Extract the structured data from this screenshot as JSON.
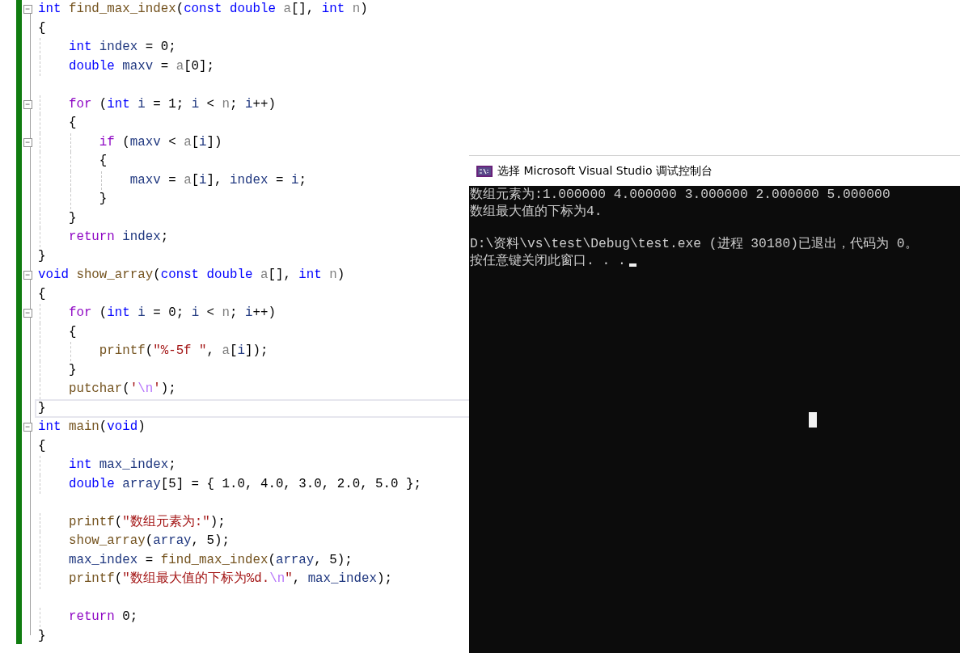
{
  "editor": {
    "lines": [
      {
        "expanded": true,
        "highlighted": false,
        "tokens": [
          {
            "text": "int",
            "kind": "kw"
          },
          {
            "text": " find_max_index",
            "kind": "fn"
          },
          {
            "text": "(",
            "kind": "plain"
          },
          {
            "text": "const",
            "kind": "kw"
          },
          {
            "text": " double",
            "kind": "kw"
          },
          {
            "text": " a",
            "kind": "param"
          },
          {
            "text": "[], ",
            "kind": "plain"
          },
          {
            "text": "int",
            "kind": "kw"
          },
          {
            "text": " n",
            "kind": "param"
          },
          {
            "text": ")",
            "kind": "plain"
          }
        ]
      },
      {
        "highlighted": false,
        "tokens": [
          {
            "text": "{",
            "kind": "plain"
          }
        ]
      },
      {
        "highlighted": false,
        "tokens": [
          {
            "text": "    int",
            "kind": "kw"
          },
          {
            "text": " index",
            "kind": "var"
          },
          {
            "text": " = 0;",
            "kind": "plain"
          }
        ]
      },
      {
        "highlighted": false,
        "tokens": [
          {
            "text": "    double",
            "kind": "kw"
          },
          {
            "text": " maxv",
            "kind": "var"
          },
          {
            "text": " = ",
            "kind": "plain"
          },
          {
            "text": "a",
            "kind": "param"
          },
          {
            "text": "[0];",
            "kind": "plain"
          }
        ]
      },
      {
        "highlighted": false
      },
      {
        "expanded": true,
        "highlighted": false,
        "tokens": [
          {
            "text": "    for",
            "kind": "ctl"
          },
          {
            "text": " (",
            "kind": "plain"
          },
          {
            "text": "int",
            "kind": "kw"
          },
          {
            "text": " i",
            "kind": "var"
          },
          {
            "text": " = 1; ",
            "kind": "plain"
          },
          {
            "text": "i",
            "kind": "var"
          },
          {
            "text": " < ",
            "kind": "plain"
          },
          {
            "text": "n",
            "kind": "param"
          },
          {
            "text": "; ",
            "kind": "plain"
          },
          {
            "text": "i",
            "kind": "var"
          },
          {
            "text": "++)",
            "kind": "plain"
          }
        ]
      },
      {
        "highlighted": false,
        "tokens": [
          {
            "text": "    {",
            "kind": "plain"
          }
        ]
      },
      {
        "expanded": true,
        "highlighted": false,
        "tokens": [
          {
            "text": "        if",
            "kind": "ctl"
          },
          {
            "text": " (",
            "kind": "plain"
          },
          {
            "text": "maxv",
            "kind": "var"
          },
          {
            "text": " < ",
            "kind": "plain"
          },
          {
            "text": "a",
            "kind": "param"
          },
          {
            "text": "[",
            "kind": "plain"
          },
          {
            "text": "i",
            "kind": "var"
          },
          {
            "text": "])",
            "kind": "plain"
          }
        ]
      },
      {
        "highlighted": false,
        "tokens": [
          {
            "text": "        {",
            "kind": "plain"
          }
        ]
      },
      {
        "highlighted": false,
        "tokens": [
          {
            "text": "            maxv",
            "kind": "var"
          },
          {
            "text": " = ",
            "kind": "plain"
          },
          {
            "text": "a",
            "kind": "param"
          },
          {
            "text": "[",
            "kind": "plain"
          },
          {
            "text": "i",
            "kind": "var"
          },
          {
            "text": "], ",
            "kind": "plain"
          },
          {
            "text": "index",
            "kind": "var"
          },
          {
            "text": " = ",
            "kind": "plain"
          },
          {
            "text": "i",
            "kind": "var"
          },
          {
            "text": ";",
            "kind": "plain"
          }
        ]
      },
      {
        "highlighted": false,
        "tokens": [
          {
            "text": "        }",
            "kind": "plain"
          }
        ]
      },
      {
        "highlighted": false,
        "tokens": [
          {
            "text": "    }",
            "kind": "plain"
          }
        ]
      },
      {
        "highlighted": false,
        "tokens": [
          {
            "text": "    return",
            "kind": "ctl"
          },
          {
            "text": " index",
            "kind": "var"
          },
          {
            "text": ";",
            "kind": "plain"
          }
        ]
      },
      {
        "highlighted": false,
        "tokens": [
          {
            "text": "}",
            "kind": "plain"
          }
        ]
      },
      {
        "expanded": true,
        "highlighted": false,
        "tokens": [
          {
            "text": "void",
            "kind": "kw"
          },
          {
            "text": " show_array",
            "kind": "fn"
          },
          {
            "text": "(",
            "kind": "plain"
          },
          {
            "text": "const",
            "kind": "kw"
          },
          {
            "text": " double",
            "kind": "kw"
          },
          {
            "text": " a",
            "kind": "param"
          },
          {
            "text": "[], ",
            "kind": "plain"
          },
          {
            "text": "int",
            "kind": "kw"
          },
          {
            "text": " n",
            "kind": "param"
          },
          {
            "text": ")",
            "kind": "plain"
          }
        ]
      },
      {
        "highlighted": false,
        "tokens": [
          {
            "text": "{",
            "kind": "plain"
          }
        ]
      },
      {
        "expanded": true,
        "highlighted": false,
        "tokens": [
          {
            "text": "    for",
            "kind": "ctl"
          },
          {
            "text": " (",
            "kind": "plain"
          },
          {
            "text": "int",
            "kind": "kw"
          },
          {
            "text": " i",
            "kind": "var"
          },
          {
            "text": " = 0; ",
            "kind": "plain"
          },
          {
            "text": "i",
            "kind": "var"
          },
          {
            "text": " < ",
            "kind": "plain"
          },
          {
            "text": "n",
            "kind": "param"
          },
          {
            "text": "; ",
            "kind": "plain"
          },
          {
            "text": "i",
            "kind": "var"
          },
          {
            "text": "++)",
            "kind": "plain"
          }
        ]
      },
      {
        "highlighted": false,
        "tokens": [
          {
            "text": "    {",
            "kind": "plain"
          }
        ]
      },
      {
        "highlighted": false,
        "tokens": [
          {
            "text": "        printf",
            "kind": "fn"
          },
          {
            "text": "(",
            "kind": "plain"
          },
          {
            "text": "\"%-5f \"",
            "kind": "str"
          },
          {
            "text": ", ",
            "kind": "plain"
          },
          {
            "text": "a",
            "kind": "param"
          },
          {
            "text": "[",
            "kind": "plain"
          },
          {
            "text": "i",
            "kind": "var"
          },
          {
            "text": "]);",
            "kind": "plain"
          }
        ]
      },
      {
        "highlighted": false,
        "tokens": [
          {
            "text": "    }",
            "kind": "plain"
          }
        ]
      },
      {
        "highlighted": false,
        "tokens": [
          {
            "text": "    putchar",
            "kind": "fn"
          },
          {
            "text": "(",
            "kind": "plain"
          },
          {
            "text": "'",
            "kind": "str"
          },
          {
            "text": "\\n",
            "kind": "esc"
          },
          {
            "text": "'",
            "kind": "str"
          },
          {
            "text": ");",
            "kind": "plain"
          }
        ]
      },
      {
        "highlighted": true,
        "tokens": [
          {
            "text": "}",
            "kind": "plain"
          }
        ]
      },
      {
        "expanded": true,
        "highlighted": false,
        "tokens": [
          {
            "text": "int",
            "kind": "kw"
          },
          {
            "text": " main",
            "kind": "fn"
          },
          {
            "text": "(",
            "kind": "plain"
          },
          {
            "text": "void",
            "kind": "kw"
          },
          {
            "text": ")",
            "kind": "plain"
          }
        ]
      },
      {
        "highlighted": false,
        "tokens": [
          {
            "text": "{",
            "kind": "plain"
          }
        ]
      },
      {
        "highlighted": false,
        "tokens": [
          {
            "text": "    int",
            "kind": "kw"
          },
          {
            "text": " max_index",
            "kind": "var"
          },
          {
            "text": ";",
            "kind": "plain"
          }
        ]
      },
      {
        "highlighted": false,
        "tokens": [
          {
            "text": "    double",
            "kind": "kw"
          },
          {
            "text": " array",
            "kind": "var"
          },
          {
            "text": "[5] = { 1.0, 4.0, 3.0, 2.0, 5.0 };",
            "kind": "plain"
          }
        ]
      },
      {
        "highlighted": false
      },
      {
        "highlighted": false,
        "tokens": [
          {
            "text": "    printf",
            "kind": "fn"
          },
          {
            "text": "(",
            "kind": "plain"
          },
          {
            "text": "\"数组元素为:\"",
            "kind": "str"
          },
          {
            "text": ");",
            "kind": "plain"
          }
        ]
      },
      {
        "highlighted": false,
        "tokens": [
          {
            "text": "    show_array",
            "kind": "fn"
          },
          {
            "text": "(",
            "kind": "plain"
          },
          {
            "text": "array",
            "kind": "var"
          },
          {
            "text": ", 5);",
            "kind": "plain"
          }
        ]
      },
      {
        "highlighted": false,
        "tokens": [
          {
            "text": "    max_index",
            "kind": "var"
          },
          {
            "text": " = ",
            "kind": "plain"
          },
          {
            "text": "find_max_index",
            "kind": "fn"
          },
          {
            "text": "(",
            "kind": "plain"
          },
          {
            "text": "array",
            "kind": "var"
          },
          {
            "text": ", 5);",
            "kind": "plain"
          }
        ]
      },
      {
        "highlighted": false,
        "tokens": [
          {
            "text": "    printf",
            "kind": "fn"
          },
          {
            "text": "(",
            "kind": "plain"
          },
          {
            "text": "\"数组最大值的下标为%d.",
            "kind": "str"
          },
          {
            "text": "\\n",
            "kind": "esc"
          },
          {
            "text": "\"",
            "kind": "str"
          },
          {
            "text": ", ",
            "kind": "plain"
          },
          {
            "text": "max_index",
            "kind": "var"
          },
          {
            "text": ");",
            "kind": "plain"
          }
        ]
      },
      {
        "highlighted": false
      },
      {
        "highlighted": false,
        "tokens": [
          {
            "text": "    return",
            "kind": "ctl"
          },
          {
            "text": " 0;",
            "kind": "plain"
          }
        ]
      },
      {
        "highlighted": false,
        "tokens": [
          {
            "text": "}",
            "kind": "plain"
          }
        ]
      }
    ]
  },
  "console": {
    "title": "选择 Microsoft Visual Studio 调试控制台",
    "blocks": [
      [
        "数组元素为:1.000000 4.000000 3.000000 2.000000 5.000000",
        "数组最大值的下标为4."
      ],
      [
        "D:\\资料\\vs\\test\\Debug\\test.exe (进程 30180)已退出，代码为 0。",
        "按任意键关闭此窗口. . ."
      ]
    ]
  }
}
